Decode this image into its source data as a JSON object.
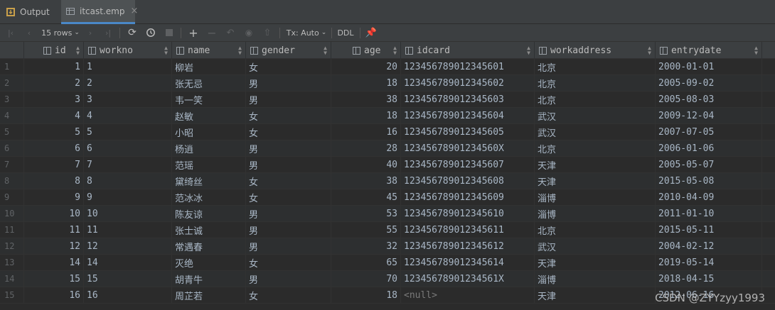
{
  "tabs": [
    {
      "label": "Output",
      "icon": "output-icon"
    },
    {
      "label": "itcast.emp",
      "icon": "table-icon"
    }
  ],
  "toolbar": {
    "rows_label": "15 rows",
    "tx_label": "Tx: Auto",
    "ddl_label": "DDL"
  },
  "columns": [
    "id",
    "workno",
    "name",
    "gender",
    "age",
    "idcard",
    "workaddress",
    "entrydate"
  ],
  "rows": [
    {
      "rn": "1",
      "id": "1",
      "workno": "1",
      "name": "柳岩",
      "gender": "女",
      "age": "20",
      "idcard": "123456789012345601",
      "workaddress": "北京",
      "entrydate": "2000-01-01"
    },
    {
      "rn": "2",
      "id": "2",
      "workno": "2",
      "name": "张无忌",
      "gender": "男",
      "age": "18",
      "idcard": "123456789012345602",
      "workaddress": "北京",
      "entrydate": "2005-09-02"
    },
    {
      "rn": "3",
      "id": "3",
      "workno": "3",
      "name": "韦一笑",
      "gender": "男",
      "age": "38",
      "idcard": "123456789012345603",
      "workaddress": "北京",
      "entrydate": "2005-08-03"
    },
    {
      "rn": "4",
      "id": "4",
      "workno": "4",
      "name": "赵敏",
      "gender": "女",
      "age": "18",
      "idcard": "123456789012345604",
      "workaddress": "武汉",
      "entrydate": "2009-12-04"
    },
    {
      "rn": "5",
      "id": "5",
      "workno": "5",
      "name": "小昭",
      "gender": "女",
      "age": "16",
      "idcard": "123456789012345605",
      "workaddress": "武汉",
      "entrydate": "2007-07-05"
    },
    {
      "rn": "6",
      "id": "6",
      "workno": "6",
      "name": "杨逍",
      "gender": "男",
      "age": "28",
      "idcard": "12345678901234560X",
      "workaddress": "北京",
      "entrydate": "2006-01-06"
    },
    {
      "rn": "7",
      "id": "7",
      "workno": "7",
      "name": "范瑶",
      "gender": "男",
      "age": "40",
      "idcard": "123456789012345607",
      "workaddress": "天津",
      "entrydate": "2005-05-07"
    },
    {
      "rn": "8",
      "id": "8",
      "workno": "8",
      "name": "黛绮丝",
      "gender": "女",
      "age": "38",
      "idcard": "123456789012345608",
      "workaddress": "天津",
      "entrydate": "2015-05-08"
    },
    {
      "rn": "9",
      "id": "9",
      "workno": "9",
      "name": "范冰冰",
      "gender": "女",
      "age": "45",
      "idcard": "123456789012345609",
      "workaddress": "淄博",
      "entrydate": "2010-04-09"
    },
    {
      "rn": "10",
      "id": "10",
      "workno": "10",
      "name": "陈友谅",
      "gender": "男",
      "age": "53",
      "idcard": "123456789012345610",
      "workaddress": "淄博",
      "entrydate": "2011-01-10"
    },
    {
      "rn": "11",
      "id": "11",
      "workno": "11",
      "name": "张士诚",
      "gender": "男",
      "age": "55",
      "idcard": "123456789012345611",
      "workaddress": "北京",
      "entrydate": "2015-05-11"
    },
    {
      "rn": "12",
      "id": "12",
      "workno": "12",
      "name": "常遇春",
      "gender": "男",
      "age": "32",
      "idcard": "123456789012345612",
      "workaddress": "武汉",
      "entrydate": "2004-02-12"
    },
    {
      "rn": "13",
      "id": "14",
      "workno": "14",
      "name": "灭绝",
      "gender": "女",
      "age": "65",
      "idcard": "123456789012345614",
      "workaddress": "天津",
      "entrydate": "2019-05-14"
    },
    {
      "rn": "14",
      "id": "15",
      "workno": "15",
      "name": "胡青牛",
      "gender": "男",
      "age": "70",
      "idcard": "12345678901234561X",
      "workaddress": "淄博",
      "entrydate": "2018-04-15"
    },
    {
      "rn": "15",
      "id": "16",
      "workno": "16",
      "name": "周芷若",
      "gender": "女",
      "age": "18",
      "idcard": "<null>",
      "workaddress": "天津",
      "entrydate": "2012-06-16"
    }
  ],
  "watermark": "CSDN @ZYYzyy1993",
  "colors": {
    "accent": "#4a88c7",
    "background": "#2b2b2b",
    "text": "#a9b7c6"
  }
}
